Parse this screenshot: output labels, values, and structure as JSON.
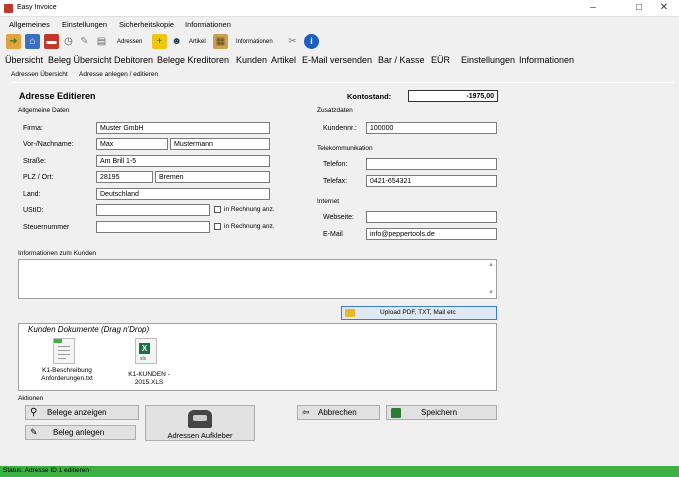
{
  "window": {
    "title": "Easy Invoice",
    "minimize": "–",
    "maximize": "□",
    "close": "✕"
  },
  "menu": [
    "Allgemeines",
    "Einstellungen",
    "Sicherheitskopie",
    "Informationen"
  ],
  "toolbar": {
    "adressen_label": "Adressen",
    "artikel_label": "Artikel",
    "informationen_label": "Informationen"
  },
  "tabs": [
    "Übersicht",
    "Beleg Übersicht Debitoren",
    "Belege Kreditoren",
    "Kunden",
    "Artikel",
    "E-Mail versenden",
    "Bar / Kasse",
    "EÜR",
    "Einstellungen",
    "Informationen"
  ],
  "breadcrumb": [
    "Adressen Übersicht",
    "Adresse anlegen / editieren"
  ],
  "form": {
    "title": "Adresse Editieren",
    "kontostand_label": "Kontostand:",
    "kontostand_value": "-1975,00",
    "allgemeine_daten": "Allgemeine Daten",
    "zusatzdaten": "Zusatzdaten",
    "telekommunikation": "Telekommunikation",
    "internet": "Internet",
    "fields": {
      "firma": {
        "label": "Firma:",
        "value": "Muster GmbH"
      },
      "name": {
        "label": "Vor-/Nachname:",
        "first": "Max",
        "last": "Mustermann"
      },
      "strasse": {
        "label": "Straße:",
        "value": "Am Brill 1-5"
      },
      "plzort": {
        "label": "PLZ / Ort:",
        "plz": "28195",
        "ort": "Bremen"
      },
      "land": {
        "label": "Land:",
        "value": "Deutschland"
      },
      "ustid": {
        "label": "UStID:",
        "value": "",
        "check_label": "in Rechnung anz."
      },
      "steuernummer": {
        "label": "Steuernummer",
        "value": "",
        "check_label": "in Rechnung anz."
      },
      "kundennr": {
        "label": "Kundennr.:",
        "value": "100000"
      },
      "telefon": {
        "label": "Telefon:",
        "value": ""
      },
      "telefax": {
        "label": "Telefax:",
        "value": "0421-654321"
      },
      "webseite": {
        "label": "Webseite:",
        "value": ""
      },
      "email": {
        "label": "E-Mail",
        "value": "info@peppertools.de"
      }
    },
    "info_label": "Informationen zum Kunden",
    "upload_label": "Upload PDF, TXT, Mail etc",
    "docs_title": "Kunden Dokumente (Drag n'Drop)",
    "documents": [
      {
        "name": "K1-Beschreibung Anforderungen.txt",
        "icon": "text-file-icon"
      },
      {
        "name": "K1-KUNDEN - 2015.XLS",
        "icon": "excel-file-icon"
      }
    ],
    "aktionen": "Aktionen",
    "buttons": {
      "belege_anzeigen": "Belege anzeigen",
      "beleg_anlegen": "Beleg anlegen",
      "adressen_aufkleber": "Adressen Aufkleber",
      "abbrechen": "Abbrechen",
      "speichern": "Speichern"
    }
  },
  "status": "Status:  Adresse ID 1 editieren",
  "colors": {
    "status_bar": "#3cb043",
    "input_border": "#7a7a7a"
  }
}
